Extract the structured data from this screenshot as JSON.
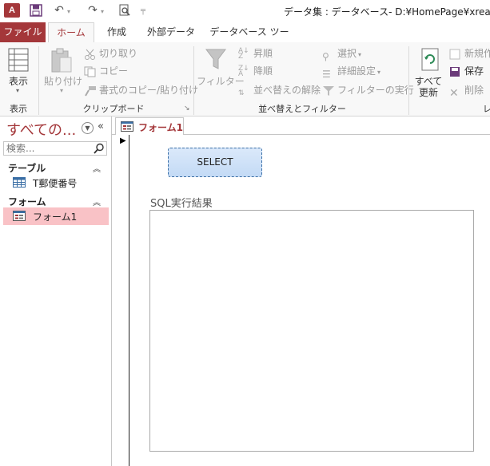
{
  "titlebar": {
    "app_logo": "A",
    "title": "データ集 : データベース- D:¥HomePage¥xrea¥acc"
  },
  "ribbon_tabs": [
    "ファイル",
    "ホーム",
    "作成",
    "外部データ",
    "データベース ツール"
  ],
  "ribbon": {
    "view": {
      "label": "表示",
      "group": "表示"
    },
    "clipboard": {
      "paste": "貼り付け",
      "cut": "切り取り",
      "copy": "コピー",
      "format_painter": "書式のコピー/貼り付け",
      "group": "クリップボード"
    },
    "sort_filter": {
      "filter": "フィルター",
      "ascending": "昇順",
      "descending": "降順",
      "clear_sort": "並べ替えの解除",
      "selection": "選択",
      "advanced": "詳細設定",
      "toggle_filter": "フィルターの実行",
      "group": "並べ替えとフィルター"
    },
    "records": {
      "refresh_all_line1": "すべて",
      "refresh_all_line2": "更新",
      "new": "新規作",
      "save": "保存",
      "delete": "削除",
      "group_partial": "レ"
    }
  },
  "nav": {
    "title": "すべての...",
    "search_placeholder": "検索...",
    "sections": [
      {
        "title": "テーブル",
        "items": [
          "T郵便番号"
        ]
      },
      {
        "title": "フォーム",
        "items": [
          "フォーム1"
        ]
      }
    ]
  },
  "document": {
    "tab_label": "フォーム1",
    "select_button": "SELECT",
    "result_label": "SQL実行結果",
    "result_text": ""
  },
  "colors": {
    "accent": "#a4373a",
    "selected_item_bg": "#f9c2c6",
    "button_blue": "#c3daf5"
  }
}
